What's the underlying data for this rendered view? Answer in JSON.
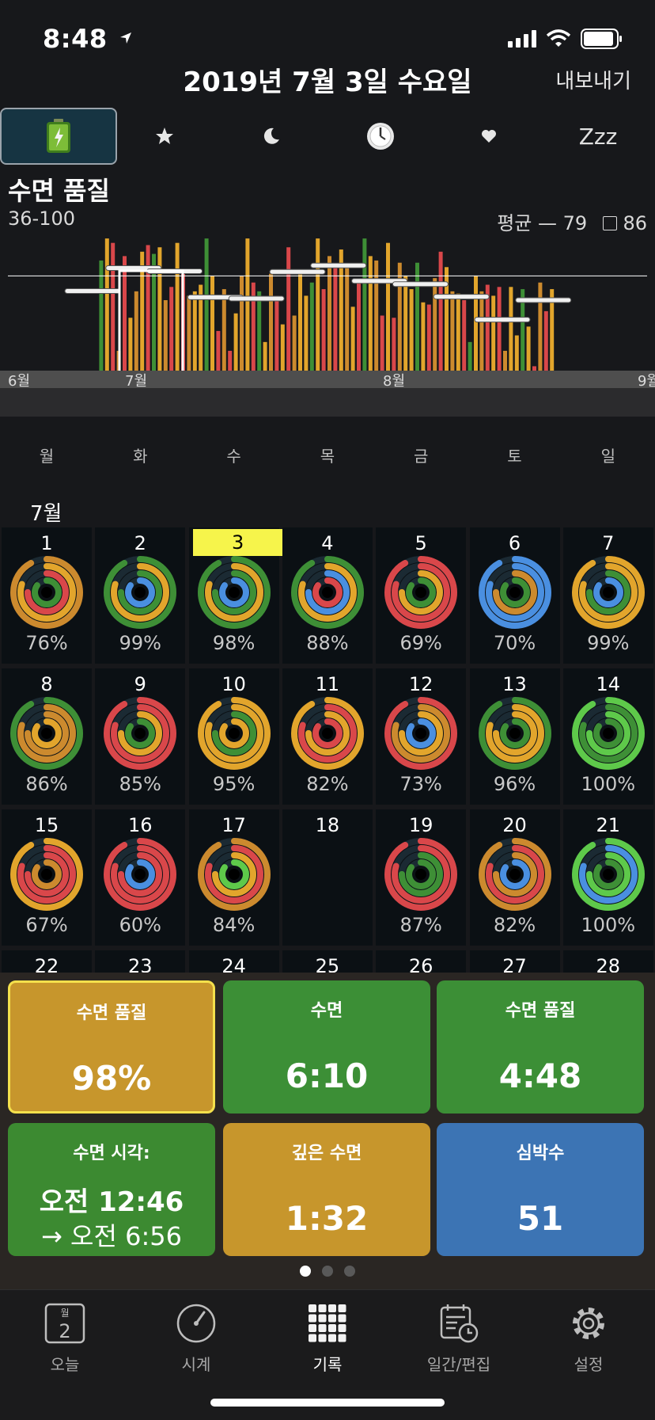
{
  "status": {
    "time": "8:48"
  },
  "header": {
    "title": "2019년 7월 3일 수요일",
    "export_label": "내보내기"
  },
  "icon_tabs": [
    {
      "icon": "battery-icon",
      "active": true
    },
    {
      "icon": "star-icon",
      "active": false
    },
    {
      "icon": "moon-icon",
      "active": false
    },
    {
      "icon": "clock-icon",
      "active": false
    },
    {
      "icon": "heart-icon",
      "active": false
    },
    {
      "icon": "zzz-icon",
      "label": "Zzz",
      "active": false
    }
  ],
  "chart": {
    "title": "수면 품질",
    "range": "36-100",
    "avg_label": "평균 — 79",
    "square_value": "86",
    "month_labels": [
      "6월",
      "7월",
      "8월",
      "9월"
    ],
    "weekdays": [
      "월",
      "화",
      "수",
      "목",
      "금",
      "토",
      "일"
    ]
  },
  "colors": {
    "green": "#3e8f36",
    "gold": "#e2a52c",
    "red": "#d9474a",
    "orange": "#cc8a2e",
    "blue": "#4a8fe0",
    "lime": "#5ec94a"
  },
  "chart_data": {
    "type": "bar",
    "ylim": [
      36,
      100
    ],
    "grid": false,
    "reference_line": 79,
    "values": [
      36,
      86,
      96,
      94,
      45,
      88,
      60,
      72,
      90,
      93,
      89,
      92,
      68,
      74,
      94,
      82,
      70,
      72,
      75,
      96,
      79,
      54,
      73,
      45,
      62,
      79,
      96,
      76,
      72,
      49,
      80,
      70,
      57,
      92,
      61,
      80,
      70,
      76,
      96,
      73,
      88,
      83,
      91,
      84,
      65,
      76,
      96,
      88,
      86,
      61,
      94,
      60,
      85,
      79,
      73,
      85,
      67,
      66,
      78,
      90,
      83,
      72,
      71,
      68,
      49,
      79,
      72,
      75,
      70,
      74,
      45,
      74,
      52,
      73,
      56,
      38,
      76,
      63,
      73
    ]
  },
  "calendar": {
    "month": "7월",
    "days": [
      {
        "n": "1",
        "pct": "76%",
        "rings": [
          "orange",
          "gold",
          "red",
          "green"
        ]
      },
      {
        "n": "2",
        "pct": "99%",
        "rings": [
          "green",
          "gold",
          "green",
          "blue"
        ]
      },
      {
        "n": "3",
        "pct": "98%",
        "rings": [
          "green",
          "gold",
          "green",
          "blue"
        ],
        "today": true
      },
      {
        "n": "4",
        "pct": "88%",
        "rings": [
          "green",
          "gold",
          "blue",
          "red"
        ]
      },
      {
        "n": "5",
        "pct": "69%",
        "rings": [
          "red",
          "red",
          "gold",
          "green"
        ]
      },
      {
        "n": "6",
        "pct": "70%",
        "rings": [
          "blue",
          "blue",
          "orange",
          "green"
        ]
      },
      {
        "n": "7",
        "pct": "99%",
        "rings": [
          "gold",
          "gold",
          "green",
          "blue"
        ]
      },
      {
        "n": "8",
        "pct": "86%",
        "rings": [
          "green",
          "orange",
          "orange",
          "gold"
        ]
      },
      {
        "n": "9",
        "pct": "85%",
        "rings": [
          "red",
          "red",
          "gold",
          "green"
        ]
      },
      {
        "n": "10",
        "pct": "95%",
        "rings": [
          "gold",
          "gold",
          "green",
          "gold"
        ]
      },
      {
        "n": "11",
        "pct": "82%",
        "rings": [
          "gold",
          "red",
          "gold",
          "red"
        ]
      },
      {
        "n": "12",
        "pct": "73%",
        "rings": [
          "red",
          "orange",
          "gold",
          "blue"
        ]
      },
      {
        "n": "13",
        "pct": "96%",
        "rings": [
          "green",
          "gold",
          "gold",
          "green"
        ]
      },
      {
        "n": "14",
        "pct": "100%",
        "rings": [
          "lime",
          "green",
          "lime",
          "green"
        ]
      },
      {
        "n": "15",
        "pct": "67%",
        "rings": [
          "gold",
          "red",
          "red",
          "orange"
        ]
      },
      {
        "n": "16",
        "pct": "60%",
        "rings": [
          "red",
          "red",
          "red",
          "blue"
        ]
      },
      {
        "n": "17",
        "pct": "84%",
        "rings": [
          "orange",
          "red",
          "gold",
          "lime"
        ]
      },
      {
        "n": "18",
        "pct": "",
        "rings": []
      },
      {
        "n": "19",
        "pct": "87%",
        "rings": [
          "red",
          "red",
          "green",
          "green"
        ]
      },
      {
        "n": "20",
        "pct": "82%",
        "rings": [
          "orange",
          "red",
          "orange",
          "blue"
        ]
      },
      {
        "n": "21",
        "pct": "100%",
        "rings": [
          "lime",
          "blue",
          "lime",
          "green"
        ]
      },
      {
        "n": "22",
        "pct": "",
        "rings": []
      },
      {
        "n": "23",
        "pct": "",
        "rings": []
      },
      {
        "n": "24",
        "pct": "",
        "rings": []
      },
      {
        "n": "25",
        "pct": "",
        "rings": []
      },
      {
        "n": "26",
        "pct": "",
        "rings": []
      },
      {
        "n": "27",
        "pct": "",
        "rings": []
      },
      {
        "n": "28",
        "pct": "",
        "rings": []
      }
    ]
  },
  "tiles": {
    "t1": {
      "label": "수면 품질",
      "value": "98%",
      "color": "#c7962c"
    },
    "t2": {
      "label": "수면",
      "value": "6:10",
      "color": "#3c8f36"
    },
    "t3": {
      "label": "수면 품질",
      "value": "4:48",
      "color": "#3c8f36"
    },
    "t4": {
      "label": "수면 시각:",
      "value": "오전 12:46",
      "value2": "→ 오전 6:56",
      "color": "#3c8a31"
    },
    "t5": {
      "label": "깊은 수면",
      "value": "1:32",
      "color": "#c7962c"
    },
    "t6": {
      "label": "심박수",
      "value": "51",
      "color": "#3c74b4"
    }
  },
  "tabbar": {
    "today_icon_month": "월",
    "today_icon_day": "2",
    "items": [
      "오늘",
      "시계",
      "기록",
      "일간/편집",
      "설정"
    ]
  }
}
